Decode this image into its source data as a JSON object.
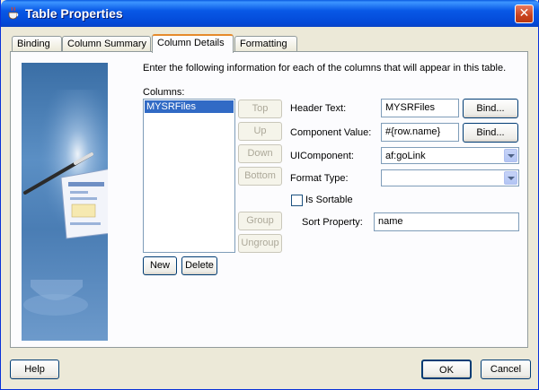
{
  "window": {
    "title": "Table Properties",
    "close_glyph": "✕",
    "accent": "#0a5ae0"
  },
  "tabs": [
    {
      "label": "Binding",
      "active": false
    },
    {
      "label": "Column Summary",
      "active": false
    },
    {
      "label": "Column Details",
      "active": true
    },
    {
      "label": "Formatting",
      "active": false
    }
  ],
  "content": {
    "instructions": "Enter the following information for each of the columns that will appear in this table.",
    "columns_label": "Columns:",
    "columns": [
      "MYSRFiles"
    ],
    "order_buttons": {
      "top": "Top",
      "up": "Up",
      "down": "Down",
      "bottom": "Bottom",
      "group": "Group",
      "ungroup": "Ungroup"
    },
    "new_button": "New",
    "delete_button": "Delete"
  },
  "form": {
    "header_text_label": "Header Text:",
    "header_text_value": "MYSRFiles",
    "component_value_label": "Component Value:",
    "component_value_value": "#{row.name}",
    "bind_button": "Bind...",
    "ui_component_label": "UIComponent:",
    "ui_component_value": "af:goLink",
    "format_type_label": "Format Type:",
    "format_type_value": "",
    "is_sortable_label": "Is Sortable",
    "is_sortable_checked": false,
    "sort_property_label": "Sort Property:",
    "sort_property_value": "name"
  },
  "footer": {
    "help_button": "Help",
    "ok_button": "OK",
    "cancel_button": "Cancel"
  }
}
